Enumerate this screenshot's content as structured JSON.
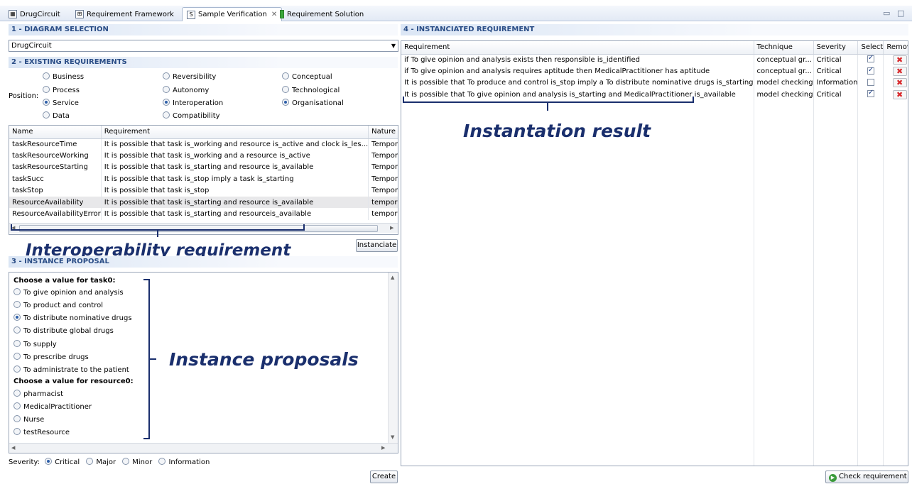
{
  "tabs": [
    {
      "label": "DrugCircuit",
      "icon": "diagram-icon"
    },
    {
      "label": "Requirement Framework",
      "icon": "grid-icon"
    },
    {
      "label": "Sample Verification",
      "icon": "verification-icon"
    },
    {
      "label": "Requirement Solution",
      "icon": "solution-icon"
    }
  ],
  "sections": {
    "diagram": "1 - DIAGRAM SELECTION",
    "existing": "2 - EXISTING REQUIREMENTS",
    "proposal": "3 - INSTANCE PROPOSAL",
    "instanciated": "4 - INSTANCIATED REQUIREMENT"
  },
  "diagram_select": {
    "value": "DrugCircuit"
  },
  "position": {
    "label": "Position:",
    "col1": [
      "Business",
      "Process",
      "Service",
      "Data"
    ],
    "col2": [
      "Reversibility",
      "Autonomy",
      "Interoperation",
      "Compatibility"
    ],
    "col3": [
      "Conceptual",
      "Technological",
      "Organisational"
    ]
  },
  "existing_table": {
    "headers": [
      "Name",
      "Requirement",
      "Nature"
    ],
    "rows": [
      [
        "taskResourceTime",
        "It is possible that task is_working and resource is_active and clock is_les...",
        "Temporal"
      ],
      [
        "taskResourceWorking",
        "It is possible that task is_working and a resource is_active",
        "Temporal"
      ],
      [
        "taskResourceStarting",
        "It is possible that task is_starting and resource is_available",
        "Temporal"
      ],
      [
        "taskSucc",
        "It is possible that task is_stop imply a task is_starting",
        "Temporal"
      ],
      [
        "taskStop",
        "It is possible that task is_stop",
        "Temporal"
      ],
      [
        "ResourceAvailability",
        "It is possible that task is_starting and resource is_available",
        "temporal"
      ],
      [
        "ResourceAvailabilityError",
        "It is possible that task is_starting and resourceis_available",
        "temporal"
      ]
    ]
  },
  "buttons": {
    "instanciate": "Instanciate",
    "create": "Create",
    "check": "Check requirement"
  },
  "proposal": {
    "task_heading": "Choose a value for task0:",
    "task_options": [
      "To give opinion and analysis",
      "To product and control",
      "To distribute nominative drugs",
      "To distribute global drugs",
      "To supply",
      "To prescribe drugs",
      "To administrate to the patient"
    ],
    "resource_heading": "Choose a value for resource0:",
    "resource_options": [
      "pharmacist",
      "MedicalPractitioner",
      "Nurse",
      "testResource"
    ]
  },
  "severity": {
    "label": "Severity:",
    "options": [
      "Critical",
      "Major",
      "Minor",
      "Information"
    ]
  },
  "instanciated_table": {
    "headers": [
      "Requirement",
      "Technique",
      "Severity",
      "Select",
      "Remove"
    ],
    "rows": [
      [
        "if To give opinion and analysis exists then responsible is_identified",
        "conceptual gr...",
        "Critical"
      ],
      [
        "if To give opinion and analysis requires aptitude then MedicalPractitioner has aptitude",
        "conceptual gr...",
        "Critical"
      ],
      [
        "It is possible that To produce and control is_stop imply a To distribute nominative drugs is_starting",
        "model checking",
        "Information"
      ],
      [
        "It is possible that To give opinion and analysis is_starting and MedicalPractitioner is_available",
        "model checking",
        "Critical"
      ]
    ]
  },
  "annotations": {
    "interop": "Interoperability requirement",
    "proposals": "Instance proposals",
    "result": "Instantation result"
  },
  "colors": {
    "annotation": "#1a2f6d",
    "section": "#2a4d86",
    "remove": "#d8262a"
  }
}
